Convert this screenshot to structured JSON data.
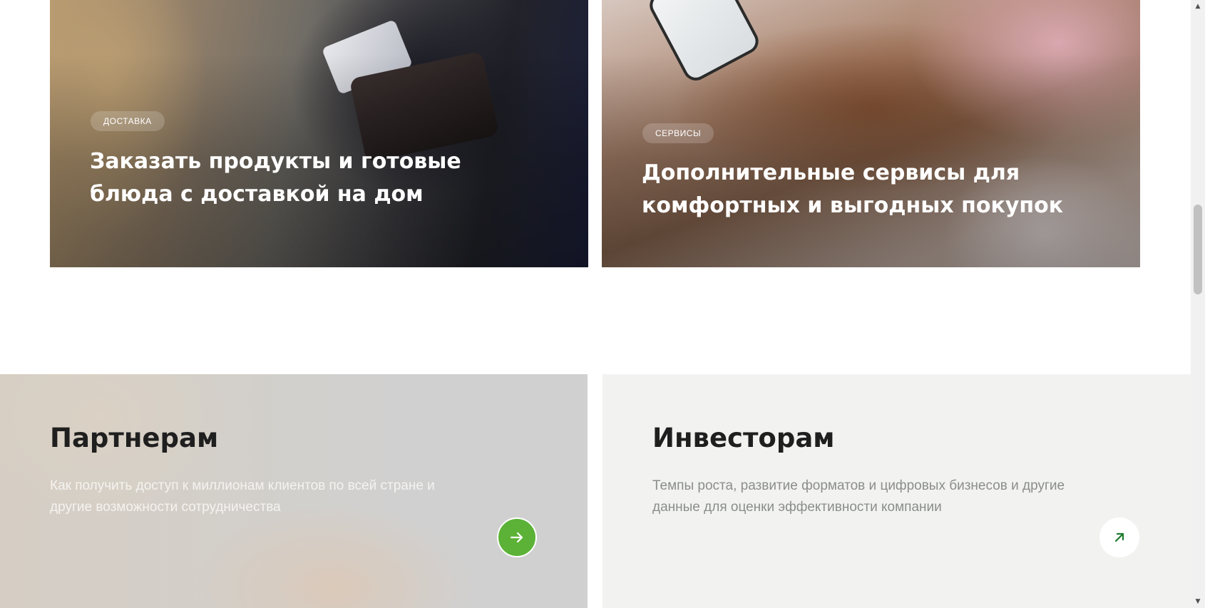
{
  "promo_cards": [
    {
      "tag": "ДОСТАВКА",
      "title_line1": "Заказать продукты и готовые",
      "title_line2": "блюда с доставкой на дом"
    },
    {
      "tag": "СЕРВИСЫ",
      "title_line1": "Дополнительные сервисы для",
      "title_line2": "комфортных и выгодных покупок"
    }
  ],
  "partners": {
    "title": "Партнерам",
    "text_line1": "Как получить доступ к миллионам клиентов по всей стране и",
    "text_line2": "другие возможности сотрудничества",
    "button_icon": "arrow-right-icon"
  },
  "investors": {
    "title": "Инвесторам",
    "text_line1": "Темпы роста, развитие форматов и цифровых бизнесов и другие",
    "text_line2": "данные для оценки эффективности компании",
    "button_icon": "arrow-up-right-icon"
  },
  "colors": {
    "accent_green": "#5bb236",
    "investors_bg": "#f2f3f1",
    "text_dark": "#1f1f1f",
    "text_muted": "#8b8d8d"
  },
  "scrollbar": {
    "up_arrow": "▲",
    "down_arrow": "▼"
  }
}
